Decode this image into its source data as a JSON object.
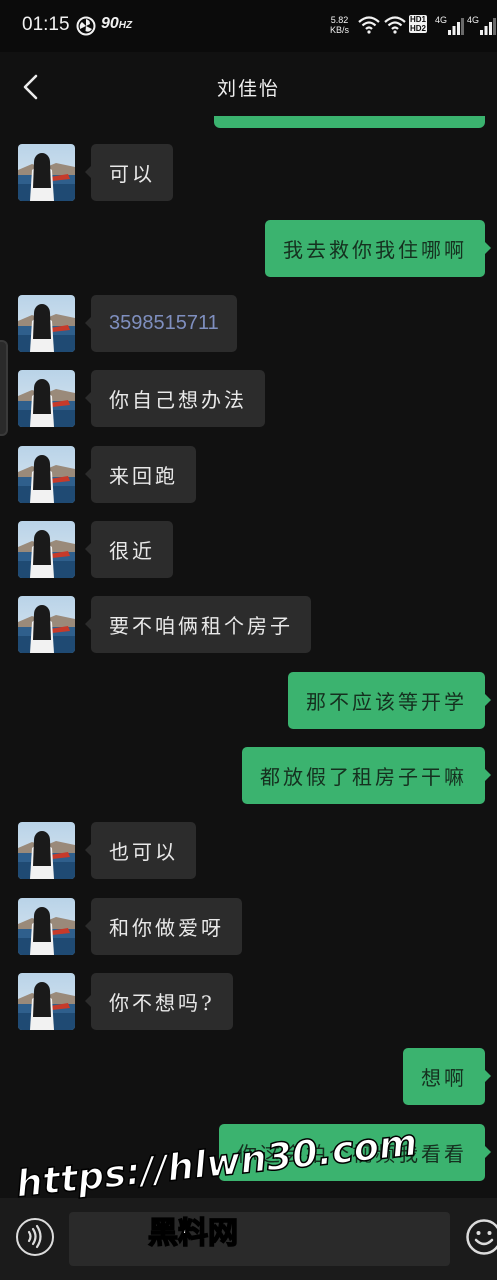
{
  "status_bar": {
    "time": "01:15",
    "refresh_rate": "90",
    "refresh_unit": "HZ",
    "net_speed_value": "5.82",
    "net_speed_unit": "KB/s",
    "hd_badge_1": "HD1",
    "hd_badge_2": "HD2",
    "signal_1": "4G",
    "signal_2": "4G"
  },
  "header": {
    "title": "刘佳怡"
  },
  "messages": [
    {
      "side": "in",
      "text": "可以"
    },
    {
      "side": "out",
      "text": "我去救你我住哪啊"
    },
    {
      "side": "in",
      "text": "3598515711"
    },
    {
      "side": "in",
      "text": "你自己想办法"
    },
    {
      "side": "in",
      "text": "来回跑"
    },
    {
      "side": "in",
      "text": "很近"
    },
    {
      "side": "in",
      "text": "要不咱俩租个房子"
    },
    {
      "side": "out",
      "text": "那不应该等开学"
    },
    {
      "side": "out",
      "text": "都放假了租房子干嘛"
    },
    {
      "side": "in",
      "text": "也可以"
    },
    {
      "side": "in",
      "text": "和你做爱呀"
    },
    {
      "side": "in",
      "text": "你不想吗?"
    },
    {
      "side": "out",
      "text": "想啊"
    },
    {
      "side": "out",
      "text": "你这会拍个视频我看看"
    }
  ],
  "input": {
    "placeholder": ""
  },
  "watermark": {
    "url": "https://hlwn30.com",
    "label": "黑料网"
  },
  "colors": {
    "background": "#111111",
    "outgoing_bubble": "#3bb36f",
    "incoming_bubble": "#2c2c2c",
    "link_text": "#7f8fbf"
  },
  "icons": [
    "back-arrow-icon",
    "avatar-photo",
    "voice-icon",
    "emoji-icon",
    "wifi-icon",
    "signal-icon",
    "fan-icon"
  ]
}
